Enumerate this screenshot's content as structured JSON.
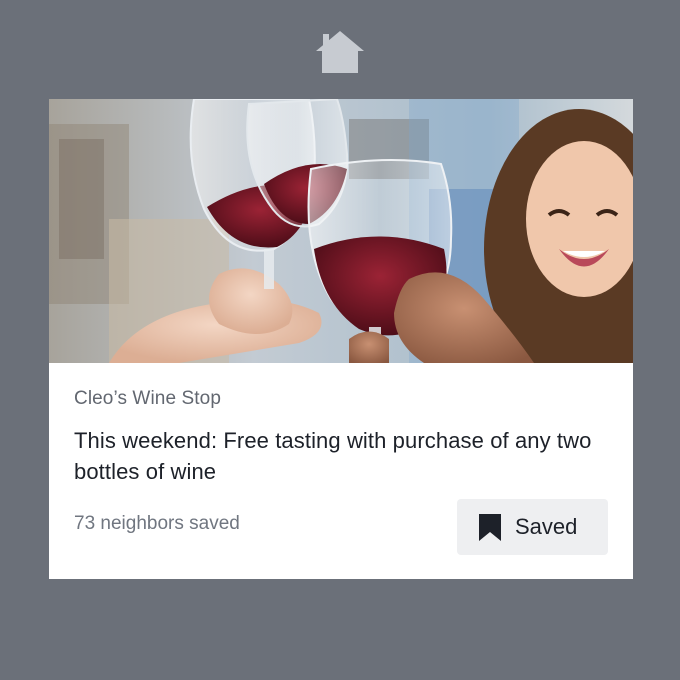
{
  "header": {
    "icon": "home-icon"
  },
  "post": {
    "image": "wine-toast-photo",
    "business_name": "Cleo’s Wine Stop",
    "headline": "This weekend: Free tasting with purchase of any two bottles of wine",
    "saved_count": "73 neighbors saved",
    "save_button": {
      "label": "Saved",
      "icon": "bookmark-icon",
      "state": "saved"
    }
  },
  "colors": {
    "background": "#6b7079",
    "card": "#ffffff",
    "button_bg": "#eeeff1",
    "text_primary": "#1d2129",
    "text_secondary": "#626770",
    "wine": "#7a1627"
  }
}
